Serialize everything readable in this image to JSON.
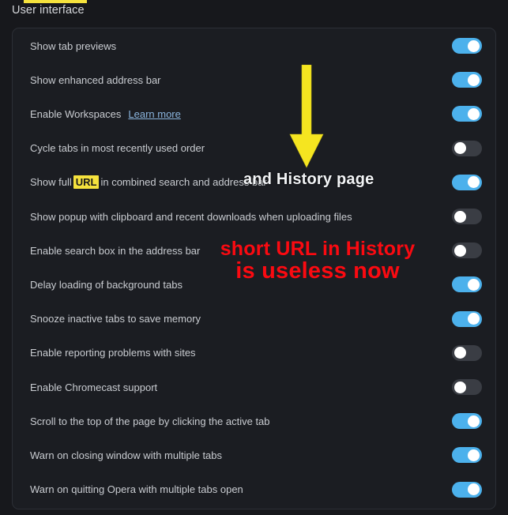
{
  "section": {
    "title": "User interface"
  },
  "rows": [
    {
      "label": "Show tab previews",
      "state": "on",
      "name": "show-tab-previews"
    },
    {
      "label": "Show enhanced address bar",
      "state": "on",
      "name": "show-enhanced-address-bar"
    },
    {
      "label": "Enable Workspaces",
      "link": "Learn more",
      "state": "on",
      "name": "enable-workspaces"
    },
    {
      "label": "Cycle tabs in most recently used order",
      "state": "off",
      "name": "cycle-tabs-mru"
    },
    {
      "label_pre": "Show full",
      "label_highlight": "URL",
      "label_post": "in combined search and address bar",
      "state": "on",
      "name": "show-full-url"
    },
    {
      "label": "Show popup with clipboard and recent downloads when uploading files",
      "state": "off",
      "name": "show-clipboard-popup"
    },
    {
      "label": "Enable search box in the address bar",
      "state": "off",
      "name": "enable-search-box"
    },
    {
      "label": "Delay loading of background tabs",
      "state": "on",
      "name": "delay-loading-background-tabs"
    },
    {
      "label": "Snooze inactive tabs to save memory",
      "state": "on",
      "name": "snooze-inactive-tabs"
    },
    {
      "label": "Enable reporting problems with sites",
      "state": "off",
      "name": "enable-reporting-problems"
    },
    {
      "label": "Enable Chromecast support",
      "state": "off",
      "name": "enable-chromecast"
    },
    {
      "label": "Scroll to the top of the page by clicking the active tab",
      "state": "on",
      "name": "scroll-to-top"
    },
    {
      "label": "Warn on closing window with multiple tabs",
      "state": "on",
      "name": "warn-closing-window"
    },
    {
      "label": "Warn on quitting Opera with multiple tabs open",
      "state": "on",
      "name": "warn-quitting-opera"
    }
  ],
  "annotations": {
    "arrow_color": "#f5e520",
    "history_note": "and History page",
    "red_line1": "short URL in History",
    "red_line2": "is useless now",
    "red_color": "#fb0a11",
    "highlight_color": "#f5e23d"
  }
}
